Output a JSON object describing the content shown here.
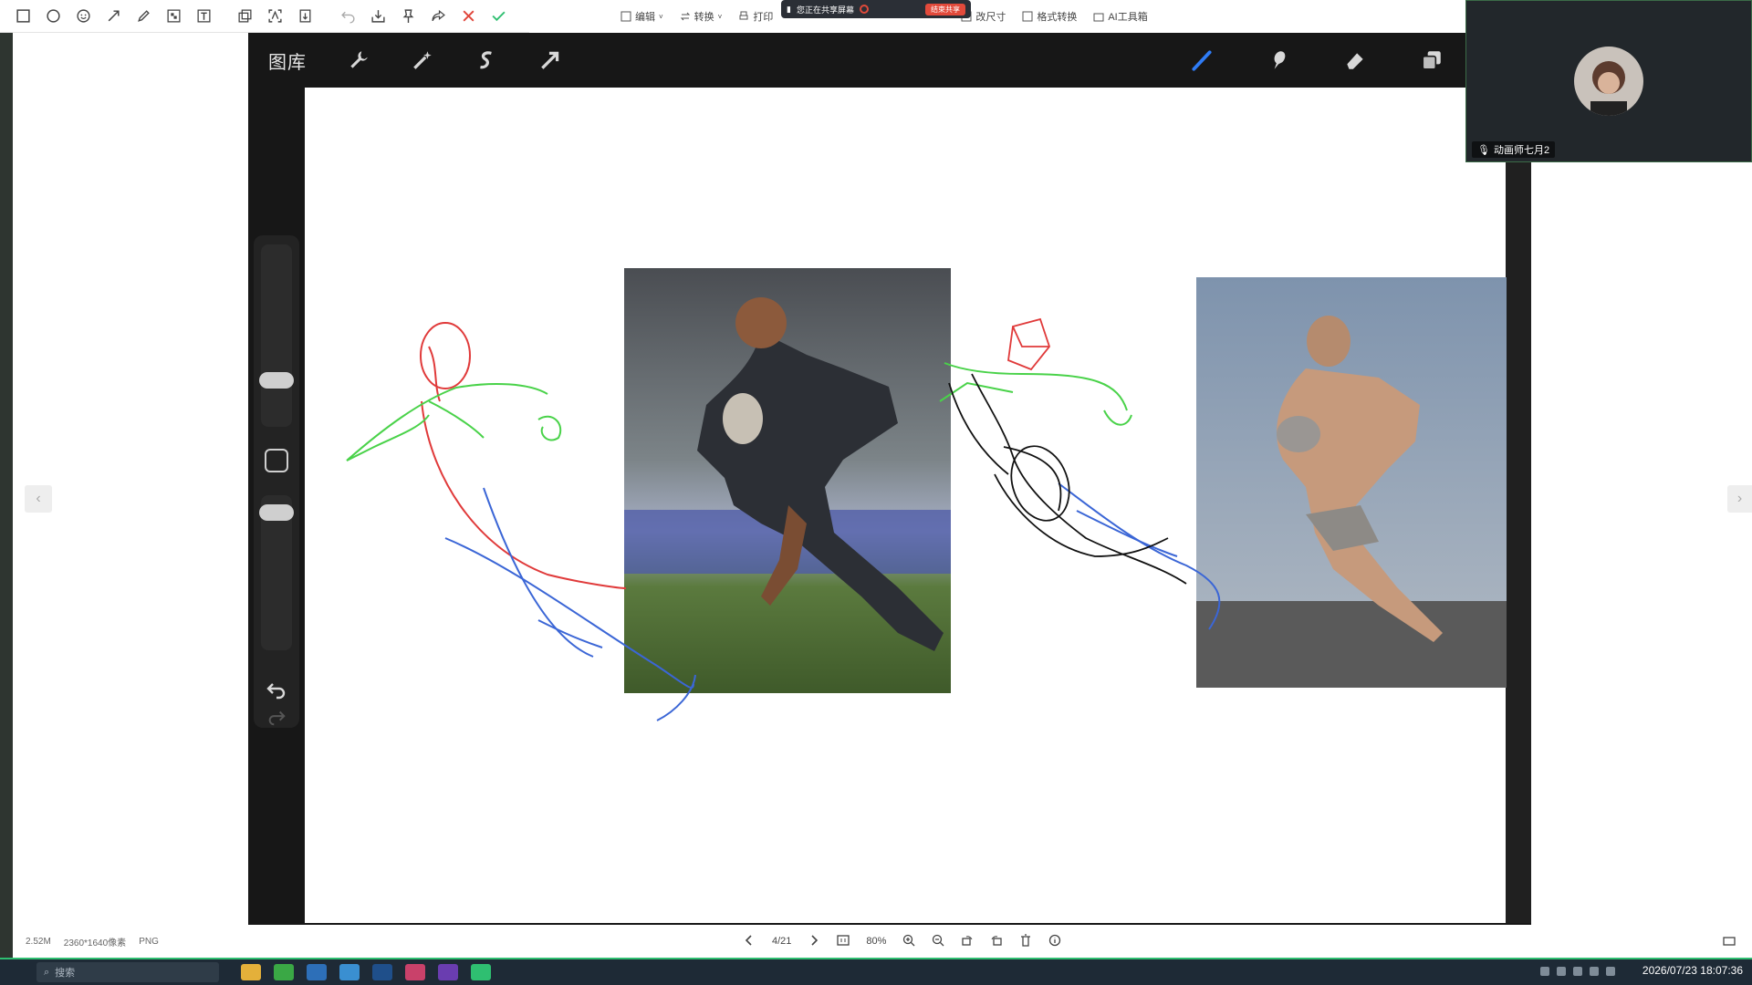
{
  "annotation_toolbar": {
    "icons": [
      "rectangle-icon",
      "circle-icon",
      "emoji-icon",
      "arrow-icon",
      "pen-icon",
      "mosaic-icon",
      "text-icon",
      "sticker-icon",
      "ocr-icon",
      "long-screenshot-icon",
      "undo-icon",
      "save-icon",
      "pin-icon",
      "share-icon",
      "close-icon",
      "confirm-icon"
    ]
  },
  "viewer_toolbar": {
    "edit": "编辑",
    "convert": "转换",
    "print": "打印",
    "resize": "改尺寸",
    "format_convert": "格式转换",
    "ai_tools": "AI工具箱"
  },
  "share_banner": {
    "text": "您正在共享屏幕",
    "stop_label": "结束共享"
  },
  "procreate": {
    "gallery_label": "图库",
    "left_tools": [
      "wrench-icon",
      "magic-wand-icon",
      "selection-icon",
      "transform-icon"
    ],
    "right_tools": [
      "brush-icon",
      "smudge-icon",
      "eraser-icon",
      "layers-icon"
    ]
  },
  "video": {
    "participant_name": "动画师七月2"
  },
  "status_bar": {
    "file_size": "2.52M",
    "dimensions": "2360*1640像素",
    "format": "PNG",
    "page": "4/21",
    "zoom": "80%"
  },
  "taskbar": {
    "search_placeholder": "搜索",
    "clock": "2026/07/23 18:07:36"
  },
  "colors": {
    "sketch_red": "#e03a3a",
    "sketch_green": "#49d249",
    "sketch_blue": "#3b66d6",
    "sketch_black": "#111111",
    "accent_green": "#2fbf71"
  }
}
